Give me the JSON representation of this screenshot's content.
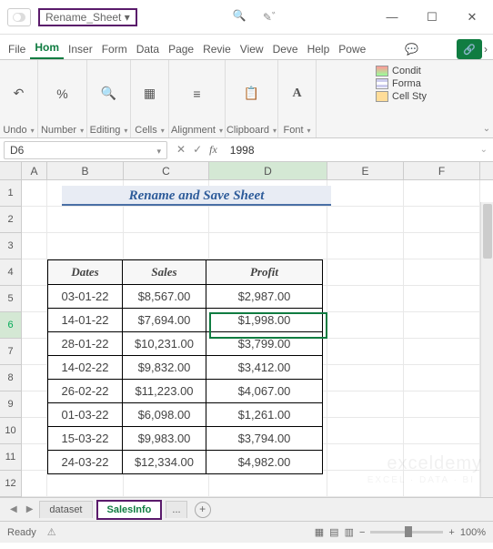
{
  "title": "Rename_Sheet ▾",
  "menu": {
    "file": "File",
    "home": "Hom",
    "insert": "Inser",
    "formulas": "Form",
    "data": "Data",
    "page": "Page",
    "review": "Revie",
    "view": "View",
    "developer": "Deve",
    "help": "Help",
    "power": "Powe"
  },
  "ribbon": {
    "undo": "Undo",
    "number": "Number",
    "editing": "Editing",
    "cells": "Cells",
    "alignment": "Alignment",
    "clipboard": "Clipboard",
    "font": "Font",
    "conditional": "Condit",
    "format_as": "Forma",
    "cell_styles": "Cell Sty"
  },
  "namebox": "D6",
  "formula_value": "1998",
  "cols": {
    "A": "A",
    "B": "B",
    "C": "C",
    "D": "D",
    "E": "E",
    "F": "F"
  },
  "rows": [
    "1",
    "2",
    "3",
    "4",
    "5",
    "6",
    "7",
    "8",
    "9",
    "10",
    "11",
    "12"
  ],
  "sheet_title": "Rename and Save Sheet",
  "headers": {
    "dates": "Dates",
    "sales": "Sales",
    "profit": "Profit"
  },
  "data": [
    {
      "date": "03-01-22",
      "sales": "$8,567.00",
      "profit": "$2,987.00"
    },
    {
      "date": "14-01-22",
      "sales": "$7,694.00",
      "profit": "$1,998.00"
    },
    {
      "date": "28-01-22",
      "sales": "$10,231.00",
      "profit": "$3,799.00"
    },
    {
      "date": "14-02-22",
      "sales": "$9,832.00",
      "profit": "$3,412.00"
    },
    {
      "date": "26-02-22",
      "sales": "$11,223.00",
      "profit": "$4,067.00"
    },
    {
      "date": "01-03-22",
      "sales": "$6,098.00",
      "profit": "$1,261.00"
    },
    {
      "date": "15-03-22",
      "sales": "$9,983.00",
      "profit": "$3,794.00"
    },
    {
      "date": "24-03-22",
      "sales": "$12,334.00",
      "profit": "$4,982.00"
    }
  ],
  "sheet_tabs": {
    "dataset": "dataset",
    "salesinfo": "SalesInfo",
    "dots": "..."
  },
  "status": {
    "ready": "Ready",
    "zoom": "100%"
  },
  "watermark": "exceldemy",
  "watermark2": "EXCEL · DATA · BI"
}
